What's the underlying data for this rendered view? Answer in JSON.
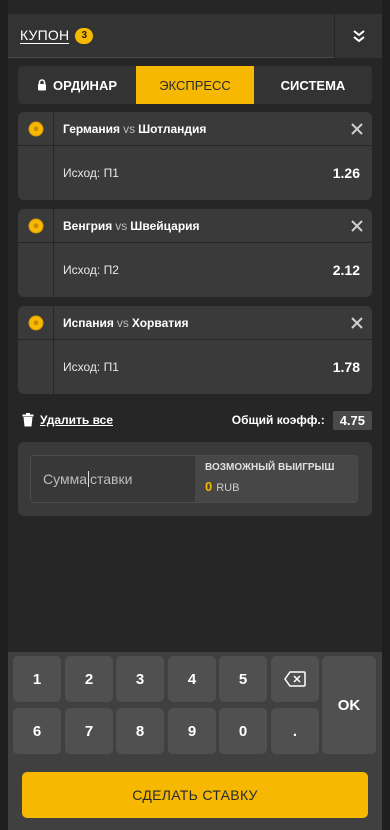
{
  "header": {
    "title": "КУПОН",
    "badge_count": "3"
  },
  "tabs": [
    {
      "label": "ОРДИНАР",
      "icon": "lock-icon",
      "active": false
    },
    {
      "label": "ЭКСПРЕСС",
      "active": true
    },
    {
      "label": "СИСТЕМА",
      "active": false
    }
  ],
  "bets": [
    {
      "team1": "Германия",
      "vs": "vs",
      "team2": "Шотландия",
      "outcome": "Исход: П1",
      "odds": "1.26"
    },
    {
      "team1": "Венгрия",
      "vs": "vs",
      "team2": "Швейцария",
      "outcome": "Исход: П2",
      "odds": "2.12"
    },
    {
      "team1": "Испания",
      "vs": "vs",
      "team2": "Хорватия",
      "outcome": "Исход: П1",
      "odds": "1.78"
    }
  ],
  "summary": {
    "delete_all": "Удалить все",
    "total_label": "Общий коэфф.:",
    "total_value": "4.75"
  },
  "stake": {
    "placeholder_before_caret": "Сумма ",
    "placeholder_after_caret": "ставки",
    "win_label": "ВОЗМОЖНЫЙ ВЫИГРЫШ",
    "win_amount": "0",
    "win_currency": "RUB"
  },
  "keypad": {
    "row1": [
      "1",
      "2",
      "3",
      "4",
      "5"
    ],
    "row2": [
      "6",
      "7",
      "8",
      "9",
      "0",
      "."
    ],
    "ok": "OK",
    "backspace_icon": "backspace-icon"
  },
  "submit_label": "СДЕЛАТЬ СТАВКУ",
  "colors": {
    "accent": "#f6b800",
    "panel": "#3a3a3a",
    "background": "#262626"
  }
}
